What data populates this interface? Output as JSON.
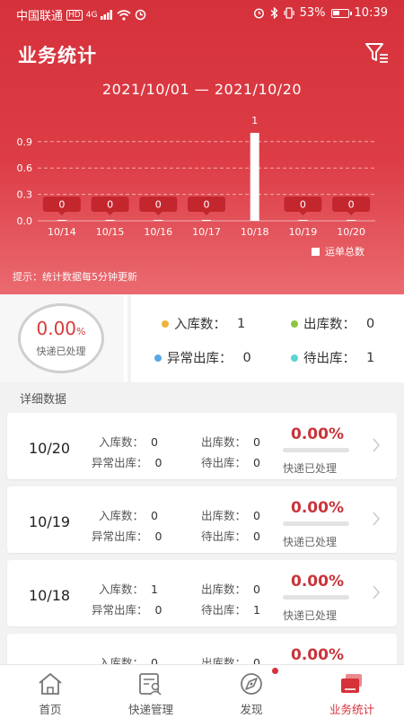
{
  "status_bar": {
    "carrier": "中国联通",
    "hd": "HD",
    "net": "4G",
    "battery": "53%",
    "battery_level": 0.53,
    "time": "10:39"
  },
  "header": {
    "title": "业务统计"
  },
  "date_range": "2021/10/01 — 2021/10/20",
  "chart_data": {
    "type": "bar",
    "categories": [
      "10/14",
      "10/15",
      "10/16",
      "10/17",
      "10/18",
      "10/19",
      "10/20"
    ],
    "series": [
      {
        "name": "运单总数",
        "values": [
          0,
          0,
          0,
          0,
          1,
          0,
          0
        ]
      }
    ],
    "data_labels": [
      "0",
      "0",
      "0",
      "0",
      "1",
      "0",
      "0"
    ],
    "y_ticks": [
      "0.0",
      "0.3",
      "0.6",
      "0.9"
    ],
    "ylim": [
      0,
      1
    ],
    "grid": true,
    "legend": "bottom-right",
    "colors": {
      "bar": "#ffffff",
      "label_bg": "#c4262e"
    }
  },
  "hint": "提示：统计数据每5分钟更新",
  "summary": {
    "percent_value": "0.00",
    "percent_sign": "%",
    "percent_label": "快递已处理",
    "stats": [
      {
        "label": "入库数：",
        "value": "1",
        "color": "#f0b43c"
      },
      {
        "label": "出库数：",
        "value": "0",
        "color": "#8cc63f"
      },
      {
        "label": "异常出库：",
        "value": "0",
        "color": "#5aa9e6"
      },
      {
        "label": "待出库：",
        "value": "1",
        "color": "#5bd3d1"
      }
    ]
  },
  "details": {
    "section_title": "详细数据",
    "rows": [
      {
        "date": "10/20",
        "in_label": "入库数：",
        "in": "0",
        "out_label": "出库数：",
        "out": "0",
        "abn_label": "异常出库：",
        "abn": "0",
        "wait_label": "待出库：",
        "wait": "0",
        "percent": "0.00%",
        "progress": 0,
        "sub": "快递已处理"
      },
      {
        "date": "10/19",
        "in_label": "入库数：",
        "in": "0",
        "out_label": "出库数：",
        "out": "0",
        "abn_label": "异常出库：",
        "abn": "0",
        "wait_label": "待出库：",
        "wait": "0",
        "percent": "0.00%",
        "progress": 0,
        "sub": "快递已处理"
      },
      {
        "date": "10/18",
        "in_label": "入库数：",
        "in": "1",
        "out_label": "出库数：",
        "out": "0",
        "abn_label": "异常出库：",
        "abn": "0",
        "wait_label": "待出库：",
        "wait": "1",
        "percent": "0.00%",
        "progress": 0,
        "sub": "快递已处理"
      },
      {
        "date": "",
        "in_label": "入库数：",
        "in": "0",
        "out_label": "出库数：",
        "out": "0",
        "abn_label": "",
        "abn": "",
        "wait_label": "",
        "wait": "",
        "percent": "0.00%",
        "progress": 0,
        "sub": ""
      }
    ]
  },
  "bottom_nav": {
    "items": [
      {
        "label": "首页",
        "icon": "home-icon"
      },
      {
        "label": "快递管理",
        "icon": "parcel-manage-icon"
      },
      {
        "label": "发现",
        "icon": "discover-icon"
      },
      {
        "label": "业务统计",
        "icon": "statistics-icon",
        "active": true
      }
    ]
  }
}
